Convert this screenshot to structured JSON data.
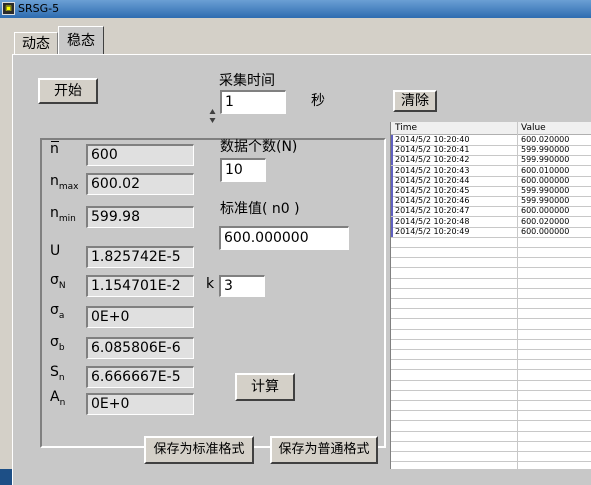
{
  "window": {
    "title": "SRSG-5",
    "icon": "labview-icon"
  },
  "tabs": [
    {
      "label": "动态"
    },
    {
      "label": "稳态"
    }
  ],
  "controls": {
    "start_label": "开始",
    "clear_label": "清除",
    "calc_label": "计算",
    "save_std_label": "保存为标准格式",
    "save_normal_label": "保存为普通格式"
  },
  "acquire": {
    "label": "采集时间",
    "value": "1",
    "unit": "秒"
  },
  "count": {
    "label": "数据个数(N)",
    "value": "10"
  },
  "standard": {
    "label": "标准值(  n0   )",
    "value": "600.000000"
  },
  "k": {
    "label": "k",
    "value": "3"
  },
  "stats": {
    "n_mean": {
      "sym": "n",
      "value": "600"
    },
    "n_max": {
      "sym": "n",
      "sub": "max",
      "value": "600.02"
    },
    "n_min": {
      "sym": "n",
      "sub": "min",
      "value": "599.98"
    },
    "U": {
      "sym": "U",
      "value": "1.825742E-5"
    },
    "sigma_N": {
      "sym": "σ",
      "sub": "N",
      "value": "1.154701E-2"
    },
    "sigma_a": {
      "sym": "σ",
      "sub": "a",
      "value": "0E+0"
    },
    "sigma_b": {
      "sym": "σ",
      "sub": "b",
      "value": "6.085806E-6"
    },
    "S_n": {
      "sym": "S",
      "sub": "n",
      "value": "6.666667E-5"
    },
    "A_n": {
      "sym": "A",
      "sub": "n",
      "value": "0E+0"
    }
  },
  "table": {
    "headers": [
      "Time",
      "Value"
    ],
    "rows": [
      {
        "time": "2014/5/2 10:20:40",
        "value": "600.020000"
      },
      {
        "time": "2014/5/2 10:20:41",
        "value": "599.990000"
      },
      {
        "time": "2014/5/2 10:20:42",
        "value": "599.990000"
      },
      {
        "time": "2014/5/2 10:20:43",
        "value": "600.010000"
      },
      {
        "time": "2014/5/2 10:20:44",
        "value": "600.000000"
      },
      {
        "time": "2014/5/2 10:20:45",
        "value": "599.990000"
      },
      {
        "time": "2014/5/2 10:20:46",
        "value": "599.990000"
      },
      {
        "time": "2014/5/2 10:20:47",
        "value": "600.000000"
      },
      {
        "time": "2014/5/2 10:20:48",
        "value": "600.020000"
      },
      {
        "time": "2014/5/2 10:20:49",
        "value": "600.000000"
      }
    ]
  }
}
